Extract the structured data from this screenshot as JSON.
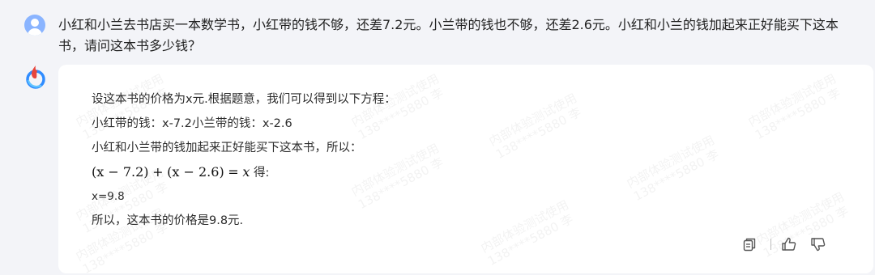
{
  "conversation": {
    "user_message": "小红和小兰去书店买一本数学书，小红带的钱不够，还差7.2元。小兰带的钱也不够，还差2.6元。小红和小兰的钱加起来正好能买下这本书，请问这本书多少钱？",
    "assistant": {
      "line1": "设这本书的价格为x元.根据题意，我们可以得到以下方程：",
      "line2": "小红带的钱：x-7.2小兰带的钱：x-2.6",
      "line3": "小红和小兰带的钱加起来正好能买下这本书，所以：",
      "equation": {
        "lhs1": "(x − 7.2)",
        "plus": "+",
        "lhs2": "(x − 2.6)",
        "equals": "=",
        "rhs": "x",
        "suffix": "得:"
      },
      "line5": "x=9.8",
      "line6": "所以，这本书的价格是9.8元."
    },
    "actions": {
      "copy_icon": "copy-icon",
      "like_icon": "thumbs-up-icon",
      "dislike_icon": "thumbs-down-icon"
    }
  },
  "watermark": {
    "line1": "内部体验测试使用",
    "line2": "138****5880 李"
  },
  "colors": {
    "page_bg": "#f3f4f8",
    "card_bg": "#ffffff",
    "user_avatar": "#8ab4ff",
    "bot_logo_red": "#e8453c",
    "bot_logo_blue": "#2f8cff"
  }
}
